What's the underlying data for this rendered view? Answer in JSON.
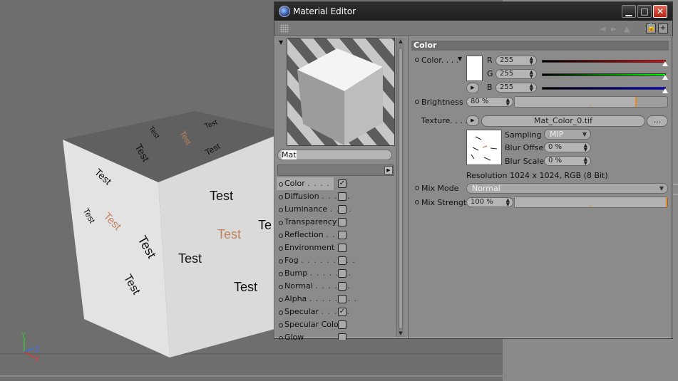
{
  "window": {
    "title": "Material Editor"
  },
  "window_buttons": {
    "minimize": "▁",
    "maximize": "□",
    "close": "✕"
  },
  "viewport": {
    "cube_labels": [
      "Test",
      "Test",
      "Test",
      "Test",
      "Test",
      "Test",
      "Test",
      "Test",
      "Test",
      "Test",
      "Test",
      "Test",
      "Test",
      "Test"
    ],
    "partial_label": "Te",
    "axis": {
      "y": "Y",
      "z": "Z",
      "x": "X"
    },
    "highlight_color": "#c0835e"
  },
  "material": {
    "name": "Mat"
  },
  "channels": [
    {
      "label": "Color",
      "dots": ". . . . . . .",
      "checked": true
    },
    {
      "label": "Diffusion",
      "dots": ". . . . .",
      "checked": false
    },
    {
      "label": "Luminance",
      "dots": ". . . .",
      "checked": false
    },
    {
      "label": "Transparency",
      "dots": "",
      "checked": false
    },
    {
      "label": "Reflection",
      "dots": ". . .",
      "checked": false
    },
    {
      "label": "Environment",
      "dots": "",
      "checked": false
    },
    {
      "label": "Fog",
      "dots": ". . . . . . . . .",
      "checked": false
    },
    {
      "label": "Bump",
      "dots": ". . . . . . .",
      "checked": false
    },
    {
      "label": "Normal",
      "dots": ". . . . . .",
      "checked": false
    },
    {
      "label": "Alpha",
      "dots": ". . . . . . . .",
      "checked": false
    },
    {
      "label": "Specular",
      "dots": ". . . . .",
      "checked": true
    },
    {
      "label": "Specular Color",
      "dots": "",
      "checked": false
    },
    {
      "label": "Glow",
      "dots": "",
      "checked": false
    }
  ],
  "color_section": {
    "header": "Color",
    "color_label": "Color. . . .",
    "r_label": "R",
    "g_label": "G",
    "b_label": "B",
    "r": "255",
    "g": "255",
    "b": "255",
    "brightness_label": "Brightness",
    "brightness": "80 %",
    "brightness_fraction": 0.8,
    "texture_label": "Texture. . . .",
    "texture_file": "Mat_Color_0.tif",
    "texture_more": "...",
    "sampling_label": "Sampling",
    "sampling": "MIP",
    "blur_offset_label": "Blur Offset",
    "blur_offset": "0 %",
    "blur_scale_label": "Blur Scale",
    "blur_scale": "0 %",
    "resolution": "Resolution 1024 x 1024, RGB (8 Bit)",
    "mix_mode_label": "Mix Mode",
    "mix_mode": "Normal",
    "mix_strength_label": "Mix Strength",
    "mix_strength": "100 %",
    "mix_strength_fraction": 1.0
  },
  "colors": {
    "slider_accent": "#e68a1a",
    "axis_y": "#37c537",
    "axis_z": "#3a6ee8",
    "axis_x": "#d83a3a"
  }
}
